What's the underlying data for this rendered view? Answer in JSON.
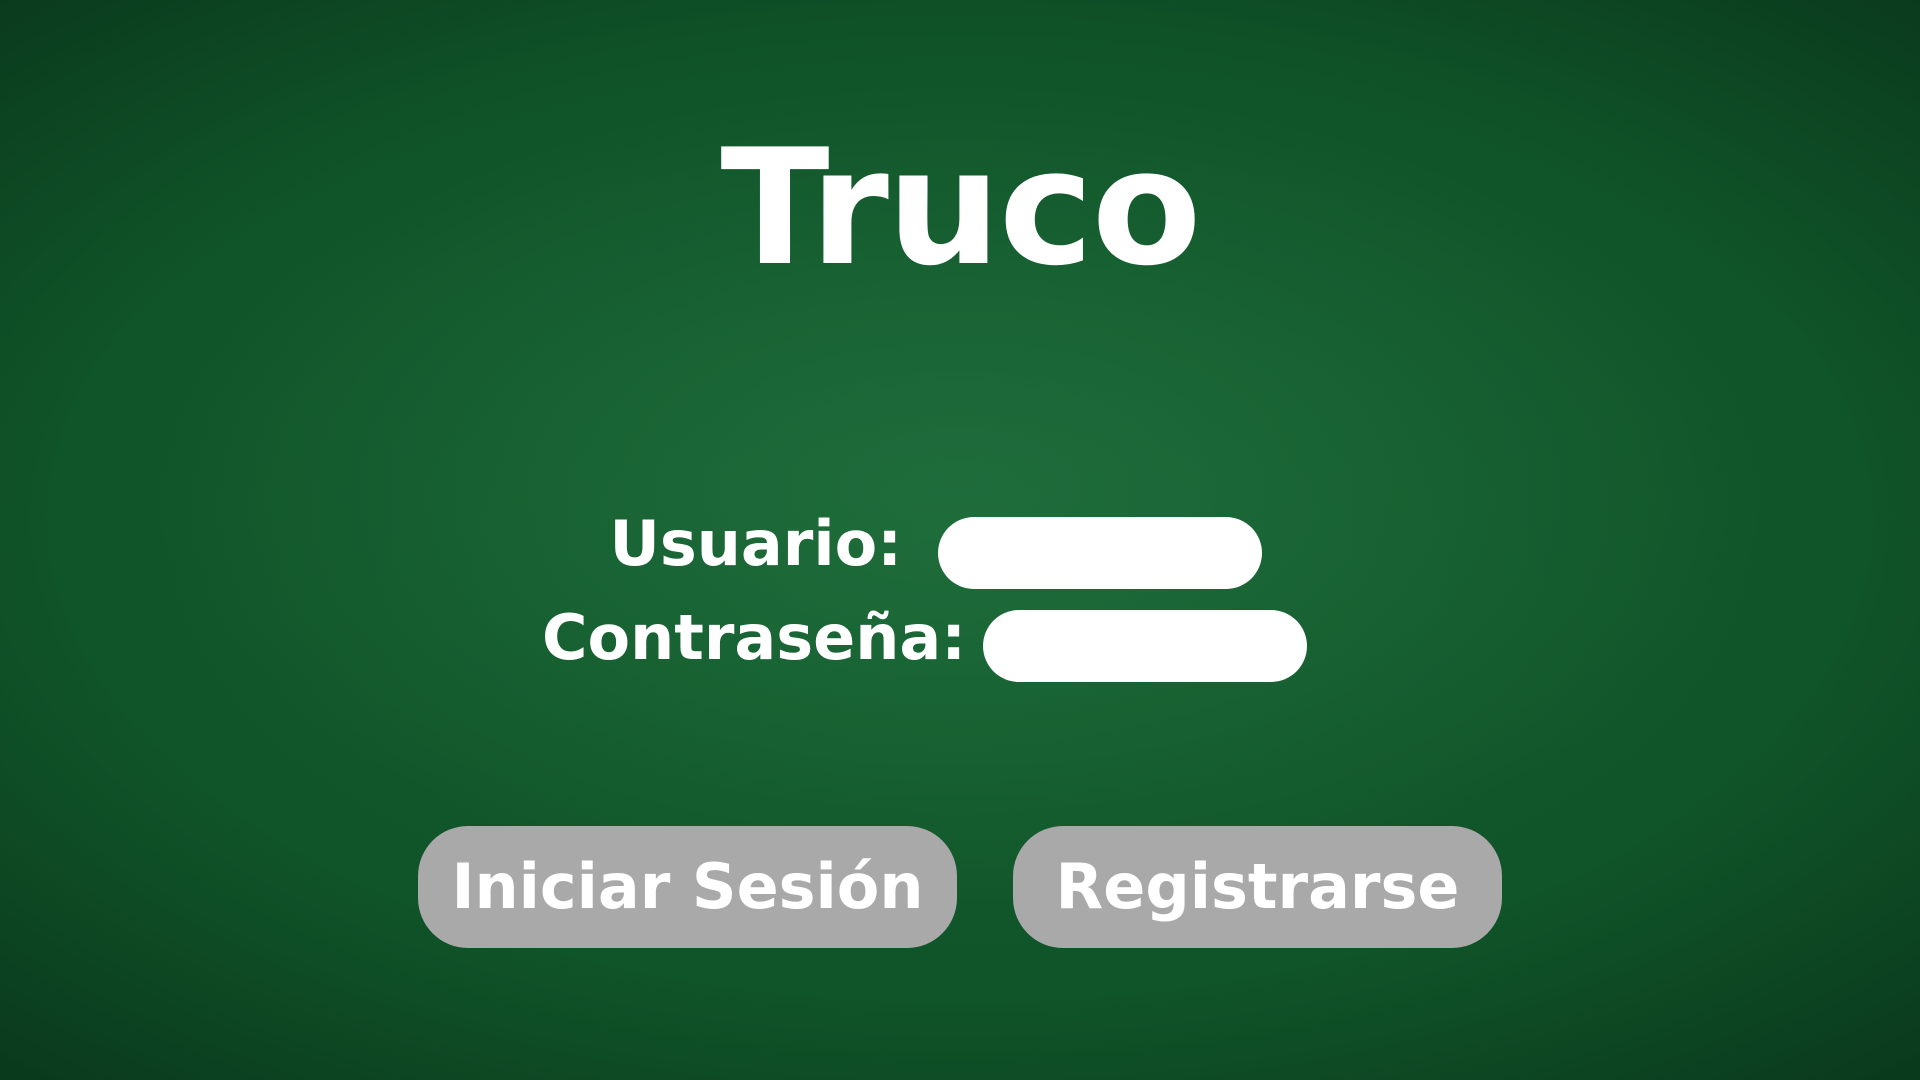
{
  "app": {
    "title": "Truco"
  },
  "login_form": {
    "username_label": "Usuario:",
    "username_value": "",
    "password_label": "Contraseña:",
    "password_value": ""
  },
  "actions": {
    "login_label": "Iniciar Sesión",
    "register_label": "Registrarse"
  },
  "colors": {
    "background": "#0f5228",
    "field_background": "#ffffff",
    "button_background": "#a9a9a9",
    "text": "#ffffff"
  }
}
